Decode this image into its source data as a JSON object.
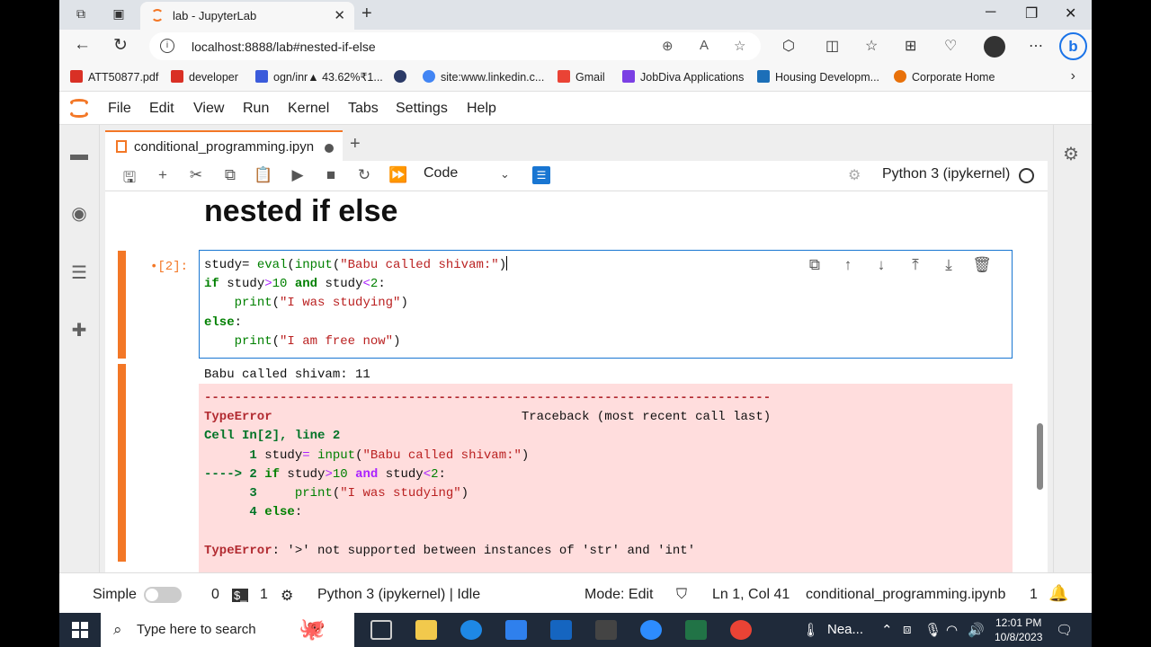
{
  "browser": {
    "tab_title": "lab - JupyterLab",
    "url": "localhost:8888/lab#nested-if-else",
    "bookmarks": [
      {
        "label": "ATT50877.pdf",
        "color": "#d93025"
      },
      {
        "label": "developer",
        "color": "#d93025"
      },
      {
        "label": "ogn/inr▲ 43.62%₹1...",
        "color": "#3b5bdb"
      },
      {
        "label": "",
        "color": "#2b3a67"
      },
      {
        "label": "site:www.linkedin.c...",
        "color": "#4285f4"
      },
      {
        "label": "Gmail",
        "color": "#ea4335"
      },
      {
        "label": "JobDiva Applications",
        "color": "#7b3fe4"
      },
      {
        "label": "Housing Developm...",
        "color": "#1c6fb8"
      },
      {
        "label": "Corporate Home",
        "color": "#e8710a"
      }
    ]
  },
  "jupyter": {
    "menu": [
      "File",
      "Edit",
      "View",
      "Run",
      "Kernel",
      "Tabs",
      "Settings",
      "Help"
    ],
    "doc_tab": "conditional_programming.ipynb",
    "cell_type": "Code",
    "kernel": "Python 3 (ipykernel)",
    "heading": "nested if else",
    "prompt": "•[2]:",
    "stdout": "Babu called shivam: 11",
    "traceback_rule": "---------------------------------------------------------------------------",
    "error_name": "TypeError",
    "traceback_label": "Traceback (most recent call last)",
    "cell_line": "Cell In[2], line 2",
    "error_message": ": '>' not supported between instances of 'str' and 'int'"
  },
  "status": {
    "mode_label": "Simple",
    "count1": "0",
    "count2": "1",
    "kernel_status": "Python 3 (ipykernel) | Idle",
    "mode": "Mode: Edit",
    "position": "Ln 1, Col 41",
    "file": "conditional_programming.ipynb",
    "count3": "1"
  },
  "taskbar": {
    "search_placeholder": "Type here to search",
    "weather": "Nea...",
    "time": "12:01 PM",
    "date": "10/8/2023"
  }
}
